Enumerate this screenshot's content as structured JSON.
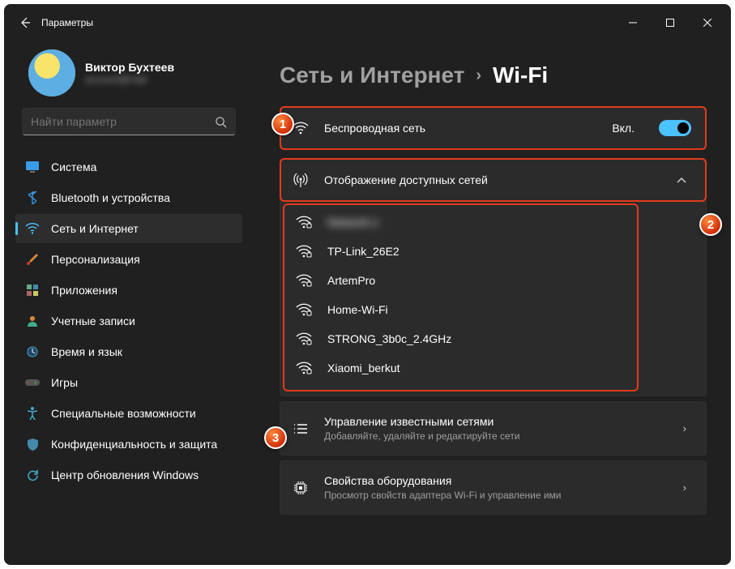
{
  "window": {
    "title": "Параметры"
  },
  "user": {
    "name": "Виктор Бухтеев",
    "sub": "account@mail"
  },
  "search": {
    "placeholder": "Найти параметр"
  },
  "nav": [
    {
      "label": "Система",
      "icon": "monitor",
      "active": false
    },
    {
      "label": "Bluetooth и устройства",
      "icon": "bluetooth",
      "active": false
    },
    {
      "label": "Сеть и Интернет",
      "icon": "wifi",
      "active": true
    },
    {
      "label": "Персонализация",
      "icon": "brush",
      "active": false
    },
    {
      "label": "Приложения",
      "icon": "apps",
      "active": false
    },
    {
      "label": "Учетные записи",
      "icon": "user",
      "active": false
    },
    {
      "label": "Время и язык",
      "icon": "clock",
      "active": false
    },
    {
      "label": "Игры",
      "icon": "gamepad",
      "active": false
    },
    {
      "label": "Специальные возможности",
      "icon": "accessibility",
      "active": false
    },
    {
      "label": "Конфиденциальность и защита",
      "icon": "shield",
      "active": false
    },
    {
      "label": "Центр обновления Windows",
      "icon": "update",
      "active": false
    }
  ],
  "breadcrumb": {
    "parent": "Сеть и Интернет",
    "current": "Wi-Fi"
  },
  "wifi_card": {
    "title": "Беспроводная сеть",
    "state_label": "Вкл.",
    "on": true
  },
  "available": {
    "title": "Отображение доступных сетей",
    "expanded": true,
    "networks": [
      {
        "name": "Network-1",
        "secured": true,
        "blurred": true
      },
      {
        "name": "TP-Link_26E2",
        "secured": true
      },
      {
        "name": "ArtemPro",
        "secured": true
      },
      {
        "name": "Home-Wi-Fi",
        "secured": true
      },
      {
        "name": "STRONG_3b0c_2.4GHz",
        "secured": true
      },
      {
        "name": "Xiaomi_berkut",
        "secured": true
      }
    ]
  },
  "known": {
    "title": "Управление известными сетями",
    "sub": "Добавляйте, удаляйте и редактируйте сети"
  },
  "hardware": {
    "title": "Свойства оборудования",
    "sub": "Просмотр свойств адаптера Wi-Fi и управление ими"
  },
  "callouts": {
    "c1": "1",
    "c2": "2",
    "c3": "3"
  }
}
